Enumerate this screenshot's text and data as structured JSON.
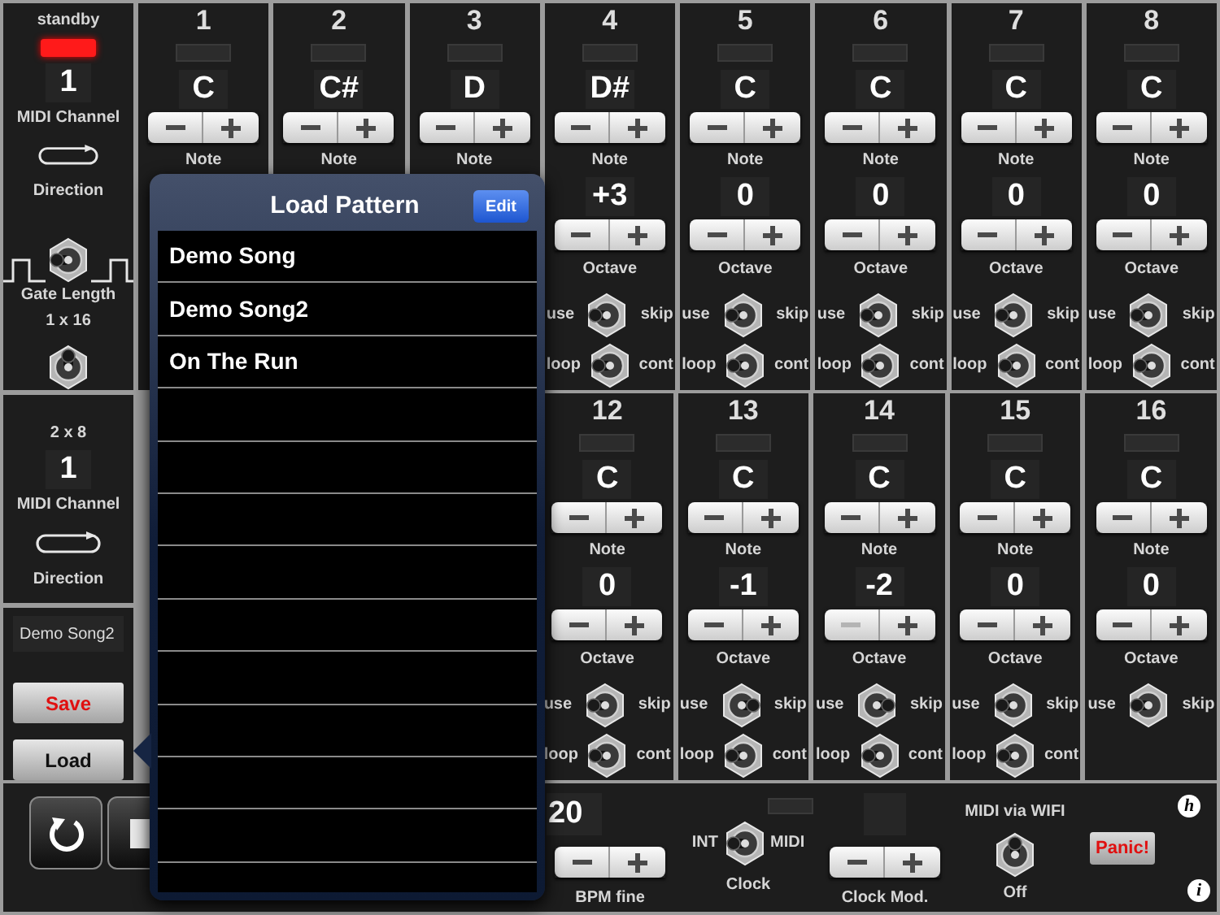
{
  "left_panel": {
    "standby_label": "standby",
    "standby_on": true,
    "tracks": [
      {
        "midi_channel": "1",
        "midi_channel_label": "MIDI Channel",
        "direction_label": "Direction"
      },
      {
        "midi_channel": "1",
        "midi_channel_label": "MIDI Channel",
        "direction_label": "Direction"
      }
    ],
    "gate_switch": {
      "left": true
    },
    "gate_length_label": "Gate Length",
    "track_modes": [
      "1 x 16",
      "2 x 8"
    ],
    "track_switch": {
      "up": true
    },
    "pattern_name": "Demo Song2",
    "save_label": "Save",
    "load_label": "Load"
  },
  "step_rows": [
    {
      "steps": [
        {
          "number": "1",
          "note": "C",
          "note_label": "Note"
        },
        {
          "number": "2",
          "note": "C#",
          "note_label": "Note"
        },
        {
          "number": "3",
          "note": "D",
          "note_label": "Note"
        },
        {
          "number": "4",
          "note": "D#",
          "note_label": "Note",
          "octave": {
            "value": "+3",
            "label": "Octave",
            "minus_disabled": false
          },
          "skip_switch": {
            "left": "use",
            "right": "skip",
            "skip": false
          },
          "loop_switch": {
            "left": "loop",
            "right": "cont",
            "cont": false
          }
        },
        {
          "number": "5",
          "note": "C",
          "note_label": "Note",
          "octave": {
            "value": "0",
            "label": "Octave",
            "minus_disabled": false
          },
          "skip_switch": {
            "left": "use",
            "right": "skip",
            "skip": false
          },
          "loop_switch": {
            "left": "loop",
            "right": "cont",
            "cont": false
          }
        },
        {
          "number": "6",
          "note": "C",
          "note_label": "Note",
          "octave": {
            "value": "0",
            "label": "Octave",
            "minus_disabled": false
          },
          "skip_switch": {
            "left": "use",
            "right": "skip",
            "skip": false
          },
          "loop_switch": {
            "left": "loop",
            "right": "cont",
            "cont": false
          }
        },
        {
          "number": "7",
          "note": "C",
          "note_label": "Note",
          "octave": {
            "value": "0",
            "label": "Octave",
            "minus_disabled": false
          },
          "skip_switch": {
            "left": "use",
            "right": "skip",
            "skip": false
          },
          "loop_switch": {
            "left": "loop",
            "right": "cont",
            "cont": false
          }
        },
        {
          "number": "8",
          "note": "C",
          "note_label": "Note",
          "octave": {
            "value": "0",
            "label": "Octave",
            "minus_disabled": false
          },
          "skip_switch": {
            "left": "use",
            "right": "skip",
            "skip": false
          },
          "loop_switch": {
            "left": "loop",
            "right": "cont",
            "cont": false
          }
        }
      ]
    },
    {
      "steps": [
        {
          "number": "12",
          "note": "C",
          "note_label": "Note",
          "octave": {
            "value": "0",
            "label": "Octave",
            "minus_disabled": false
          },
          "skip_switch": {
            "left": "use",
            "right": "skip",
            "skip": false
          },
          "loop_switch": {
            "left": "loop",
            "right": "cont",
            "cont": false
          }
        },
        {
          "number": "13",
          "note": "C",
          "note_label": "Note",
          "octave": {
            "value": "-1",
            "label": "Octave",
            "minus_disabled": false
          },
          "skip_switch": {
            "left": "use",
            "right": "skip",
            "skip": true
          },
          "loop_switch": {
            "left": "loop",
            "right": "cont",
            "cont": false
          }
        },
        {
          "number": "14",
          "note": "C",
          "note_label": "Note",
          "octave": {
            "value": "-2",
            "label": "Octave",
            "minus_disabled": true
          },
          "skip_switch": {
            "left": "use",
            "right": "skip",
            "skip": true
          },
          "loop_switch": {
            "left": "loop",
            "right": "cont",
            "cont": false
          }
        },
        {
          "number": "15",
          "note": "C",
          "note_label": "Note",
          "octave": {
            "value": "0",
            "label": "Octave",
            "minus_disabled": false
          },
          "skip_switch": {
            "left": "use",
            "right": "skip",
            "skip": false
          },
          "loop_switch": {
            "left": "loop",
            "right": "cont",
            "cont": false
          }
        },
        {
          "number": "16",
          "note": "C",
          "note_label": "Note",
          "octave": {
            "value": "0",
            "label": "Octave",
            "minus_disabled": false
          },
          "skip_switch": {
            "left": "use",
            "right": "skip",
            "skip": false
          }
        }
      ]
    }
  ],
  "bottom_bar": {
    "bpm_value": "20",
    "bpm_fine_label": "BPM fine",
    "clock": {
      "left": "INT",
      "right": "MIDI",
      "midi": false,
      "label": "Clock"
    },
    "clock_mod_label": "Clock Mod.",
    "wifi": {
      "title": "MIDI via WIFI",
      "on": false,
      "state_label": "Off"
    },
    "panic_label": "Panic!",
    "help_glyph": "h",
    "info_glyph": "i"
  },
  "popover": {
    "title": "Load Pattern",
    "edit_label": "Edit",
    "patterns": [
      "Demo Song",
      "Demo Song2",
      "On The Run"
    ]
  }
}
